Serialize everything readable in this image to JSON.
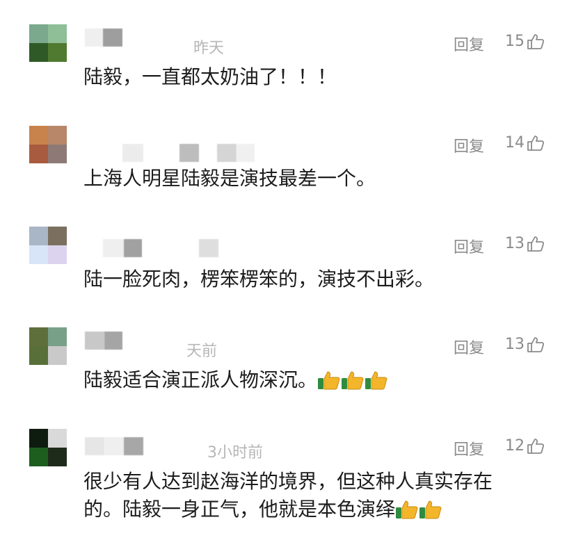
{
  "comments": [
    {
      "time": "昨天",
      "reply_label": "回复",
      "likes": "15",
      "lines": [
        "陆毅，一直都太奶油了！！！"
      ],
      "avatar_colors": [
        "#7aa98d",
        "#8ebf97",
        "#2f5a27",
        "#4f7a2f"
      ]
    },
    {
      "time": "",
      "reply_label": "回复",
      "likes": "14",
      "lines": [
        "上海人明星陆毅是演技最差一个。"
      ],
      "avatar_colors": [
        "#c7834b",
        "#b88668",
        "#a85b3e",
        "#8d7a76"
      ]
    },
    {
      "time": "",
      "reply_label": "回复",
      "likes": "13",
      "lines": [
        "陆一脸死肉，楞笨楞笨的，演技不出彩。"
      ],
      "avatar_colors": [
        "#a9b6c6",
        "#7b6f60",
        "#d8e4f7",
        "#dcd4ee"
      ]
    },
    {
      "time": "天前",
      "reply_label": "回复",
      "likes": "13",
      "lines": [
        "陆毅适合演正派人物深沉。"
      ],
      "avatar_colors": [
        "#5f6f3b",
        "#78a088",
        "#596f39",
        "#c9c9c9"
      ]
    },
    {
      "time": "3小时前",
      "reply_label": "回复",
      "likes": "12",
      "lines": [
        "很少有人达到赵海洋的境界，但这种人真实存在",
        "的。陆毅一身正气，他就是本色演绎"
      ],
      "avatar_colors": [
        "#0e1c10",
        "#d9d9d9",
        "#1d5e1f",
        "#1f2b1a"
      ]
    }
  ],
  "icons": {
    "like": "thumbs-up-outline-icon",
    "emoji": "thumbs-up-emoji-icon"
  },
  "colors": {
    "meta_text": "#8a8a8a",
    "time_text": "#b6b6b6",
    "body_text": "#1c1c1c"
  }
}
